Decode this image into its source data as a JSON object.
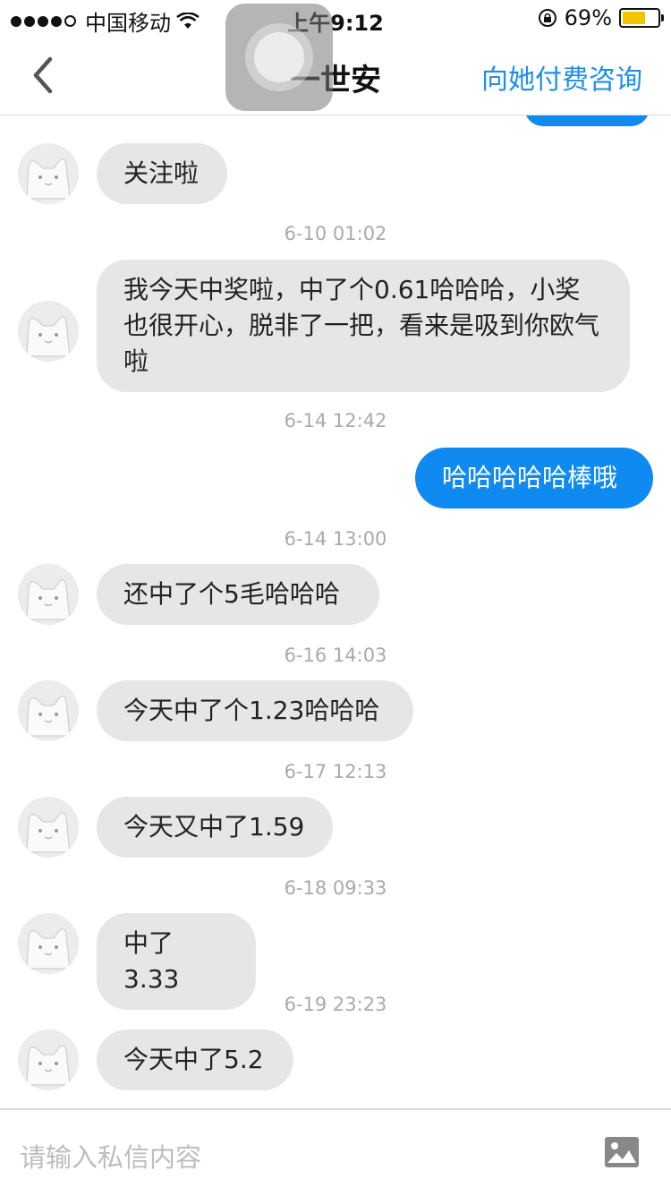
{
  "status_bar": {
    "carrier": "中国移动",
    "time": "上午9:12",
    "battery": "69%",
    "battery_level": 0.69
  },
  "nav": {
    "title": "一世安",
    "pay_label": "向她付费咨询"
  },
  "messages": [
    {
      "type": "in",
      "text": "关注啦"
    },
    {
      "type": "time",
      "text": "6-10 01:02"
    },
    {
      "type": "in",
      "text": "我今天中奖啦，中了个0.61哈哈哈，小奖也很开心，脱非了一把，看来是吸到你欧气啦"
    },
    {
      "type": "time",
      "text": "6-14 12:42"
    },
    {
      "type": "out",
      "text": "哈哈哈哈哈棒哦"
    },
    {
      "type": "time",
      "text": "6-14 13:00"
    },
    {
      "type": "in",
      "text": "还中了个5毛哈哈哈"
    },
    {
      "type": "time",
      "text": "6-16 14:03"
    },
    {
      "type": "in",
      "text": "今天中了个1.23哈哈哈"
    },
    {
      "type": "time",
      "text": "6-17 12:13"
    },
    {
      "type": "in",
      "text": "今天又中了1.59"
    },
    {
      "type": "time",
      "text": "6-18 09:33"
    },
    {
      "type": "in",
      "text": "中了3.33"
    },
    {
      "type": "time",
      "text": "6-19 23:23"
    },
    {
      "type": "in",
      "text": "今天中了5.2"
    }
  ],
  "input": {
    "placeholder": "请输入私信内容"
  },
  "colors": {
    "accent": "#1e8ef0",
    "bubble_in": "#e6e6e6",
    "bubble_out": "#0e8af0"
  }
}
